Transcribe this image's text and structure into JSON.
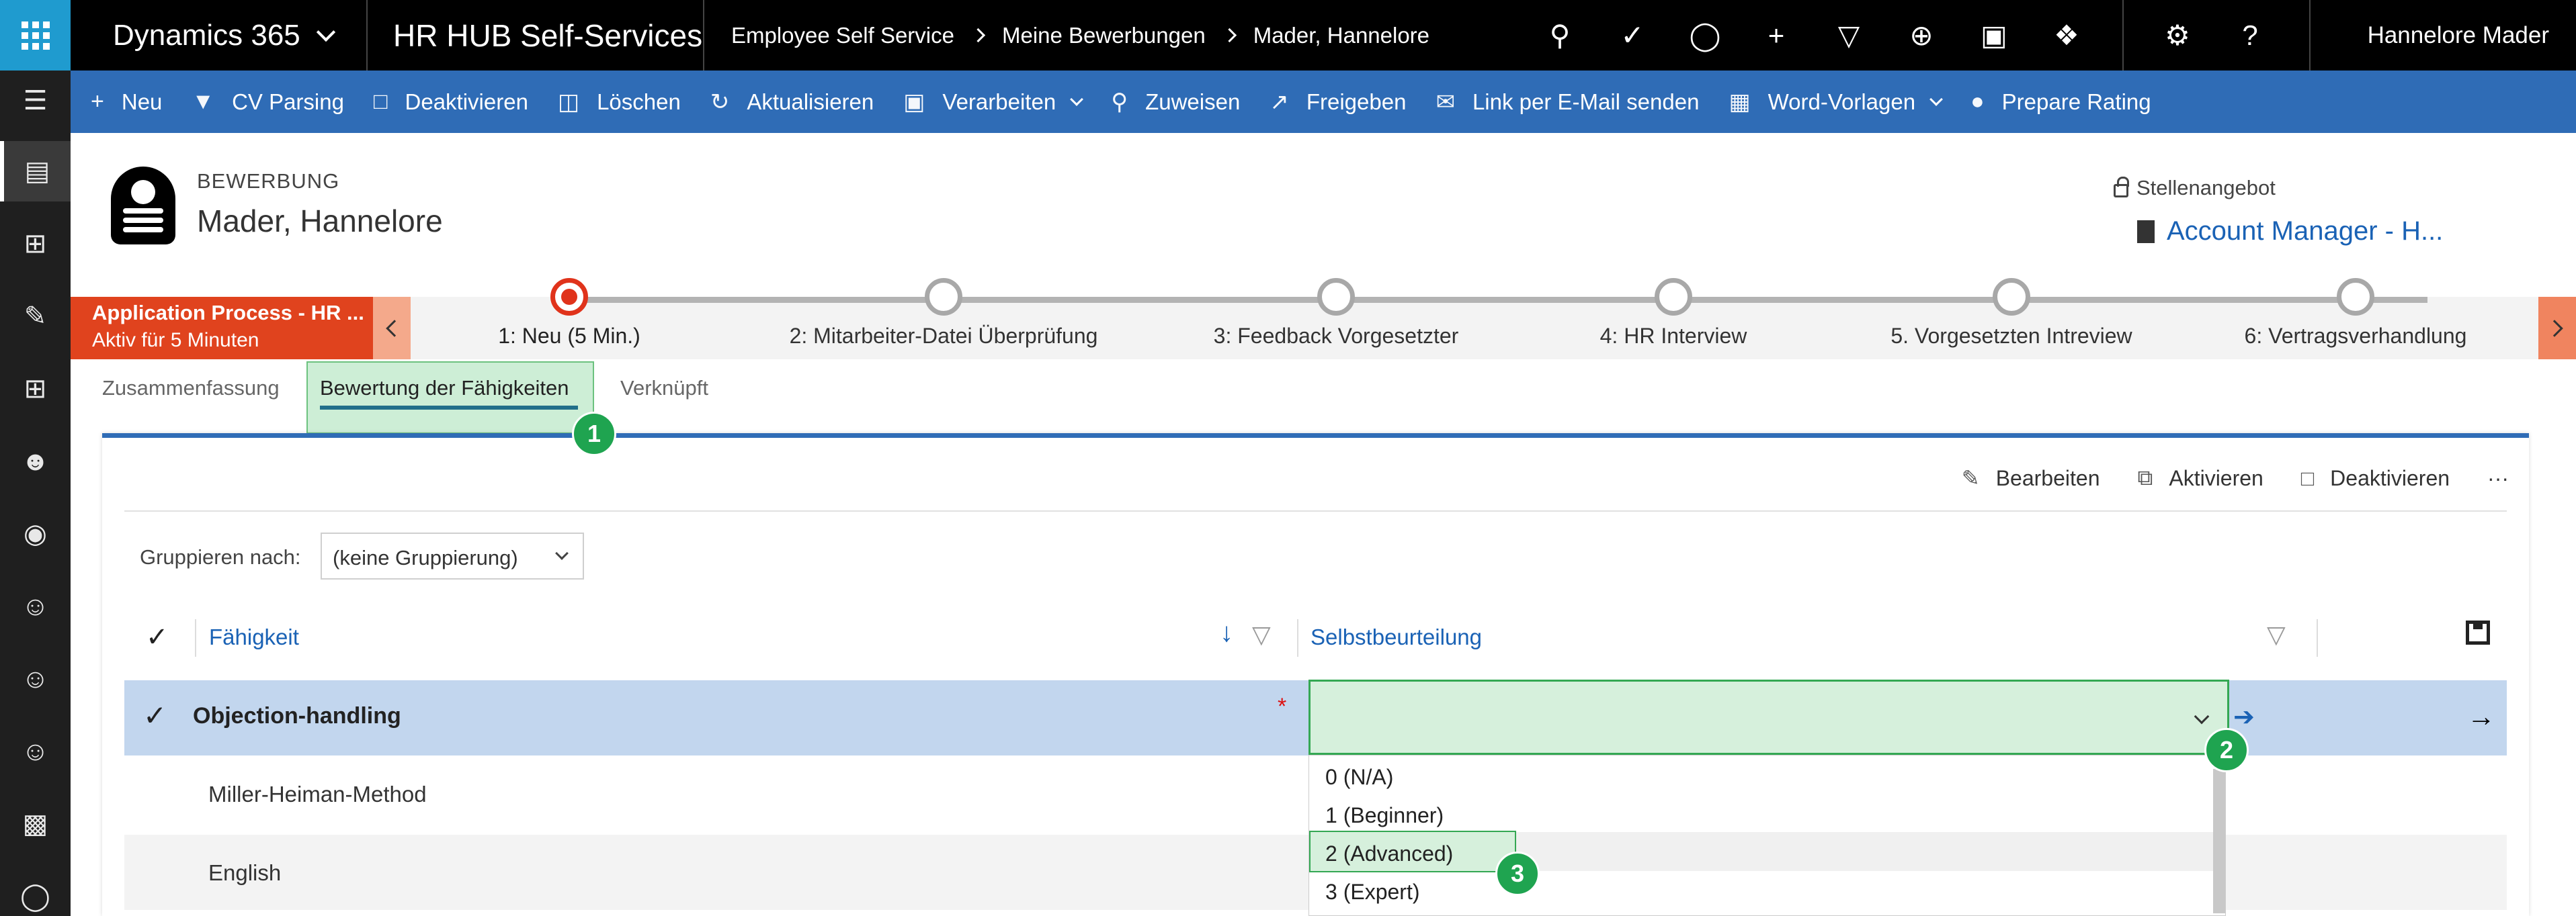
{
  "topbar": {
    "app_name": "Dynamics 365",
    "module": "HR HUB Self-Services",
    "breadcrumb": [
      "Employee Self Service",
      "Meine Bewerbungen",
      "Mader, Hannelore"
    ],
    "user": "Hannelore Mader",
    "icons": [
      "search-icon",
      "task-check-icon",
      "lightbulb-icon",
      "plus-icon",
      "filter-icon",
      "circle-plus-icon",
      "document-icon",
      "puzzle-icon",
      "gear-icon",
      "help-icon"
    ]
  },
  "commands": [
    {
      "label": "Neu",
      "icon": "plus-icon"
    },
    {
      "label": "CV Parsing",
      "icon": "filter-icon"
    },
    {
      "label": "Deaktivieren",
      "icon": "deactivate-icon"
    },
    {
      "label": "Löschen",
      "icon": "trash-icon"
    },
    {
      "label": "Aktualisieren",
      "icon": "refresh-icon"
    },
    {
      "label": "Verarbeiten",
      "icon": "flow-icon",
      "dropdown": true
    },
    {
      "label": "Zuweisen",
      "icon": "assign-icon"
    },
    {
      "label": "Freigeben",
      "icon": "share-icon"
    },
    {
      "label": "Link per E-Mail senden",
      "icon": "email-link-icon"
    },
    {
      "label": "Word-Vorlagen",
      "icon": "word-icon",
      "dropdown": true
    },
    {
      "label": "Prepare Rating",
      "icon": "person-icon"
    }
  ],
  "header": {
    "entity": "BEWERBUNG",
    "record_name": "Mader, Hannelore",
    "lookup_label": "Stellenangebot",
    "lookup_value": "Account Manager - H..."
  },
  "process": {
    "name": "Application Process - HR ...",
    "duration": "Aktiv für 5 Minuten",
    "stages": [
      "1: Neu  (5 Min.)",
      "2: Mitarbeiter-Datei Überprüfung",
      "3: Feedback Vorgesetzter",
      "4: HR Interview",
      "5. Vorgesetzten Intreview",
      "6: Vertragsverhandlung"
    ],
    "active_stage": 0
  },
  "tabs": [
    "Zusammenfassung",
    "Bewertung der Fähigkeiten",
    "Verknüpft"
  ],
  "callouts": [
    "1",
    "2",
    "3"
  ],
  "subgrid": {
    "commands": [
      "Bearbeiten",
      "Aktivieren",
      "Deaktivieren"
    ],
    "more": "···",
    "group_label": "Gruppieren nach:",
    "group_value": "(keine Gruppierung)",
    "columns": [
      "Fähigkeit",
      "Selbstbeurteilung"
    ],
    "rows": [
      "Objection-handling",
      "Miller-Heiman-Method",
      "English"
    ],
    "required_marker": "*",
    "options": [
      "0 (N/A)",
      "1 (Beginner)",
      "2 (Advanced)",
      "3 (Expert)"
    ]
  },
  "colors": {
    "topbar": "#000000",
    "waffle": "#1f9bcf",
    "commandbar": "#2f6cb6",
    "process_flyout": "#e0431e",
    "callout": "#1fa450",
    "highlight": "#d6f0dc"
  }
}
